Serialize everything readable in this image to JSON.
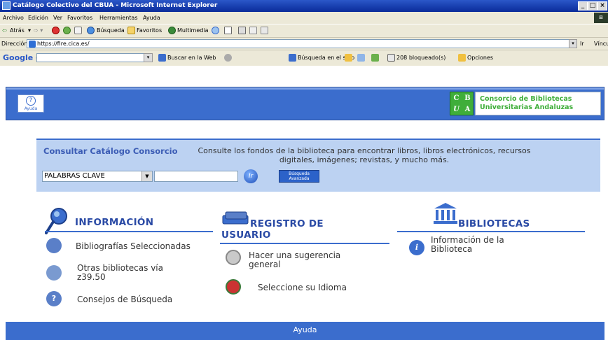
{
  "window": {
    "title": "Catálogo Colectivo del CBUA - Microsoft Internet Explorer",
    "buttons": [
      "_",
      "□",
      "×"
    ]
  },
  "menu": [
    "Archivo",
    "Edición",
    "Ver",
    "Favoritos",
    "Herramientas",
    "Ayuda"
  ],
  "toolbar": {
    "back": "Atrás",
    "search": "Búsqueda",
    "favorites": "Favoritos",
    "multimedia": "Multimedia"
  },
  "address": {
    "label": "Dirección",
    "value": "https://fire.cica.es/",
    "go": "Ir",
    "links": "Vínculos"
  },
  "google_bar": {
    "logo": "Google -",
    "search_web": "Buscar en la Web",
    "search_site": "Búsqueda en el sitio",
    "blocked": "208 bloqueado(s)",
    "options": "Opciones"
  },
  "header": {
    "help": "Ayuda",
    "logo_letters": [
      "C",
      "B",
      "U",
      "A"
    ],
    "consortium_line1": "Consorcio de Bibliotecas",
    "consortium_line2": "Universitarias Andaluzas"
  },
  "search": {
    "title": "Consultar Catálogo Consorcio",
    "description": "Consulte los fondos de la biblioteca para encontrar libros, libros electrónicos, recursos digitales, imágenes; revistas, y mucho más.",
    "select_value": "PALABRAS CLAVE",
    "go_label": "Ir",
    "advanced_line1": "Búsqueda",
    "advanced_line2": "Avanzada"
  },
  "columns": {
    "informacion": {
      "title": "INFORMACIÓN",
      "items": [
        "Bibliografías Seleccionadas",
        "Otras bibliotecas vía z39.50",
        "Consejos de Búsqueda"
      ]
    },
    "registro": {
      "title_line1": "REGISTRO DE",
      "title_line2": "USUARIO",
      "items": [
        "Hacer una sugerencia general",
        "Seleccione su Idioma"
      ]
    },
    "bibliotecas": {
      "title": "BIBLIOTECAS",
      "items": [
        "Información de la Biblioteca"
      ]
    }
  },
  "footer": {
    "label": "Ayuda"
  }
}
